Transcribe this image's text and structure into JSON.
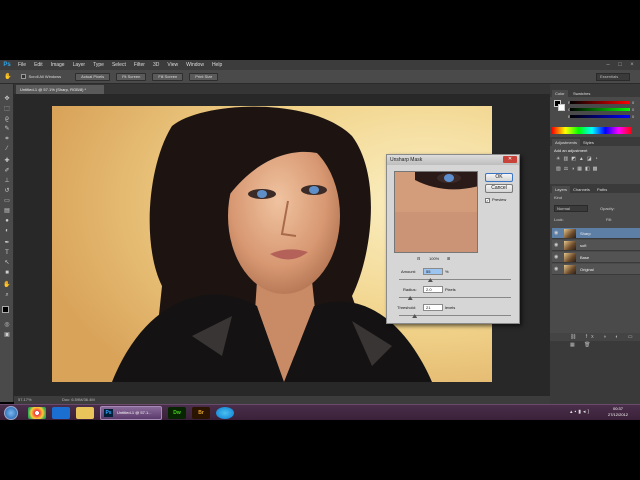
{
  "app": {
    "logo": "Ps"
  },
  "menu": [
    "File",
    "Edit",
    "Image",
    "Layer",
    "Type",
    "Select",
    "Filter",
    "3D",
    "View",
    "Window",
    "Help"
  ],
  "window_controls": [
    "–",
    "□",
    "×"
  ],
  "options_bar": {
    "checkbox_label": "Scroll All Windows",
    "buttons": [
      "Actual Pixels",
      "Fit Screen",
      "Fill Screen",
      "Print Size"
    ],
    "workspace": "Essentials"
  },
  "document": {
    "tab": "Untitled-1 @ 57.1% (Sharp, RGB/8) *",
    "zoom": "57.17%",
    "doc_size": "Doc: 6.59M/36.4M"
  },
  "panels": {
    "color_tabs": [
      "Color",
      "Swatches"
    ],
    "color_sliders": [
      {
        "label": "R",
        "value": "0"
      },
      {
        "label": "G",
        "value": "0"
      },
      {
        "label": "B",
        "value": "0"
      }
    ],
    "adjustments_tabs": [
      "Adjustments",
      "Styles"
    ],
    "adjustments_hint": "Add an adjustment",
    "layers_tabs": [
      "Layers",
      "Channels",
      "Paths"
    ],
    "kind_label": "Kind",
    "blend_mode": "Normal",
    "opacity_label": "Opacity:",
    "lock_label": "Lock:",
    "fill_label": "Fill:",
    "layers": [
      {
        "name": "Sharp",
        "selected": true
      },
      {
        "name": "soft",
        "selected": false
      },
      {
        "name": "Base",
        "selected": false
      },
      {
        "name": "Original",
        "selected": false
      }
    ]
  },
  "dialog": {
    "title": "Unsharp Mask",
    "close": "✕",
    "ok": "OK",
    "cancel": "Cancel",
    "preview_label": "Preview",
    "preview_zoom": "100%",
    "amount_label": "Amount:",
    "amount_value": "55",
    "amount_unit": "%",
    "amount_fraction": 0.28,
    "radius_label": "Radius:",
    "radius_value": "2.0",
    "radius_unit": "Pixels",
    "radius_fraction": 0.1,
    "threshold_label": "Threshold:",
    "threshold_value": "21",
    "threshold_unit": "levels",
    "threshold_fraction": 0.14
  },
  "taskbar": {
    "window_label": "Untitled-1 @ 57.1...",
    "time": "00:37",
    "date": "27/12/2012"
  },
  "colors": {
    "accent": "#2fa3e6",
    "selection": "#5d7fa6"
  }
}
